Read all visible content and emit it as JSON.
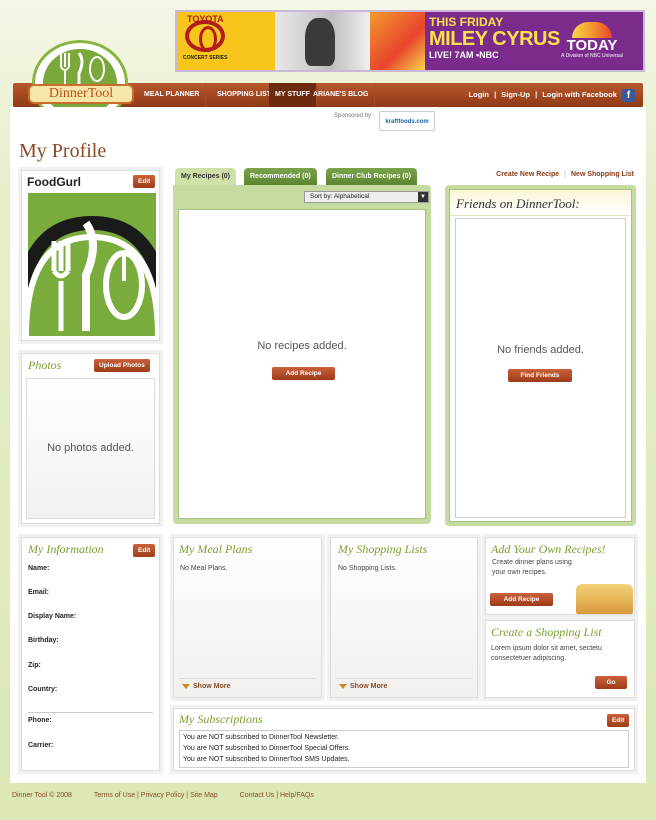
{
  "banner": {
    "brand": "TOYOTA",
    "series": "CONCERT SERIES",
    "line1": "THIS FRIDAY",
    "line2": "MILEY CYRUS",
    "line3": "LIVE! 7AM •NBC",
    "show": "TODAY",
    "show_sub": "A Division of NBC Universal"
  },
  "logo": {
    "text": "DinnerTool"
  },
  "nav": {
    "items": [
      "MEAL PLANNER",
      "SHOPPING LIST",
      "MY STUFF",
      "ARIANE'S BLOG"
    ],
    "active": "MY STUFF",
    "login": "Login",
    "signup": "Sign-Up",
    "facebook": "Login with Facebook",
    "sep": "|"
  },
  "sponsor": {
    "label": "Sponsored by:",
    "brand": "kraftfoods.com"
  },
  "page": {
    "title": "My Profile"
  },
  "profile": {
    "name": "FoodGurl",
    "edit_label": "Edit"
  },
  "photos": {
    "title": "Photos",
    "upload_label": "Upload Photos",
    "empty": "No photos added."
  },
  "tabs": [
    {
      "label": "My Recipes (0)",
      "active": true
    },
    {
      "label": "Recommended (0)",
      "active": false
    },
    {
      "label": "Dinner Club Recipes (0)",
      "active": false
    }
  ],
  "recipes": {
    "sort_value": "Sort by: Alphabetical",
    "empty": "No recipes added.",
    "add_label": "Add Recipe"
  },
  "links": {
    "create_recipe": "Create New Recipe",
    "new_list": "New Shopping List",
    "sep": "|"
  },
  "friends": {
    "title": "Friends on DinnerTool:",
    "empty": "No friends added.",
    "find_label": "Find Friends"
  },
  "info": {
    "title": "My Information",
    "edit_label": "Edit",
    "fields": [
      "Name:",
      "Email:",
      "Display Name:",
      "Birthday:",
      "Zip:",
      "Country:"
    ],
    "contact_fields": [
      "Phone:",
      "Carrier:"
    ]
  },
  "meal_plans": {
    "title": "My Meal Plans",
    "empty": "No Meal Plans.",
    "more": "Show More"
  },
  "shopping_lists": {
    "title": "My Shopping Lists",
    "empty": "No Shopping Lists.",
    "more": "Show More"
  },
  "add_recipes": {
    "title": "Add Your Own Recipes!",
    "text": "Create dinner plans using your own recipes.",
    "btn": "Add Recipe"
  },
  "create_list": {
    "title": "Create a Shopping List",
    "text": "Lorem ipsum dolor sit amet, sectetu consectetuer adipiscing.",
    "btn": "Go"
  },
  "subscriptions": {
    "title": "My Subscriptions",
    "edit_label": "Edit",
    "lines": [
      "You are NOT subscribed to DinnerTool Newsletter.",
      "You are NOT subscribed to DinnerTool Special Offers.",
      "You are NOT subscribed to DinnerTool SMS Updates."
    ]
  },
  "footer": {
    "copyright": "Dinner Tool © 2008",
    "links1": "Terms of Use | Privacy Policy | Site Map",
    "links2": "Contact Us | Help/FAQs"
  },
  "colors": {
    "accent": "#8e3a17",
    "green": "#7aa83a",
    "title": "#8a4a24"
  }
}
